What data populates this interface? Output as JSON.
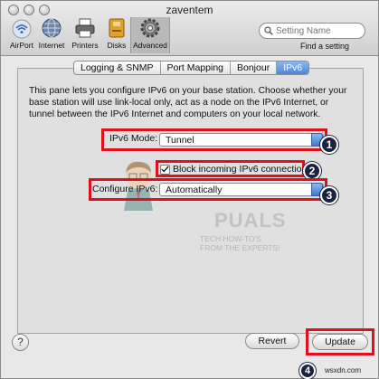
{
  "window": {
    "title": "zaventem"
  },
  "toolbar": {
    "items": [
      {
        "label": "AirPort",
        "icon": "airport-icon"
      },
      {
        "label": "Internet",
        "icon": "globe-icon"
      },
      {
        "label": "Printers",
        "icon": "printer-icon"
      },
      {
        "label": "Disks",
        "icon": "disk-icon"
      },
      {
        "label": "Advanced",
        "icon": "gear-icon",
        "selected": true
      }
    ],
    "search_placeholder": "Setting Name",
    "find_label": "Find a setting"
  },
  "tabs": [
    {
      "label": "Logging & SNMP",
      "active": false
    },
    {
      "label": "Port Mapping",
      "active": false
    },
    {
      "label": "Bonjour",
      "active": false
    },
    {
      "label": "IPv6",
      "active": true
    }
  ],
  "pane": {
    "description": "This pane lets you configure IPv6 on your base station. Choose whether your base station will use link-local only, act as a node on the IPv6 Internet, or tunnel between the IPv6 Internet and computers on your local network.",
    "mode_label": "IPv6 Mode:",
    "mode_value": "Tunnel",
    "block_label": "Block incoming IPv6 connections",
    "block_checked": true,
    "configure_label": "Configure IPv6:",
    "configure_value": "Automatically"
  },
  "annotations": {
    "badges": [
      "1",
      "2",
      "3",
      "4"
    ],
    "highlight_color": "#e0101a"
  },
  "watermark": {
    "title": "PUALS",
    "subtitle": "TECH HOW-TO'S FROM THE EXPERTS!"
  },
  "buttons": {
    "help": "?",
    "revert": "Revert",
    "update": "Update"
  },
  "site": "wsxdn.com"
}
